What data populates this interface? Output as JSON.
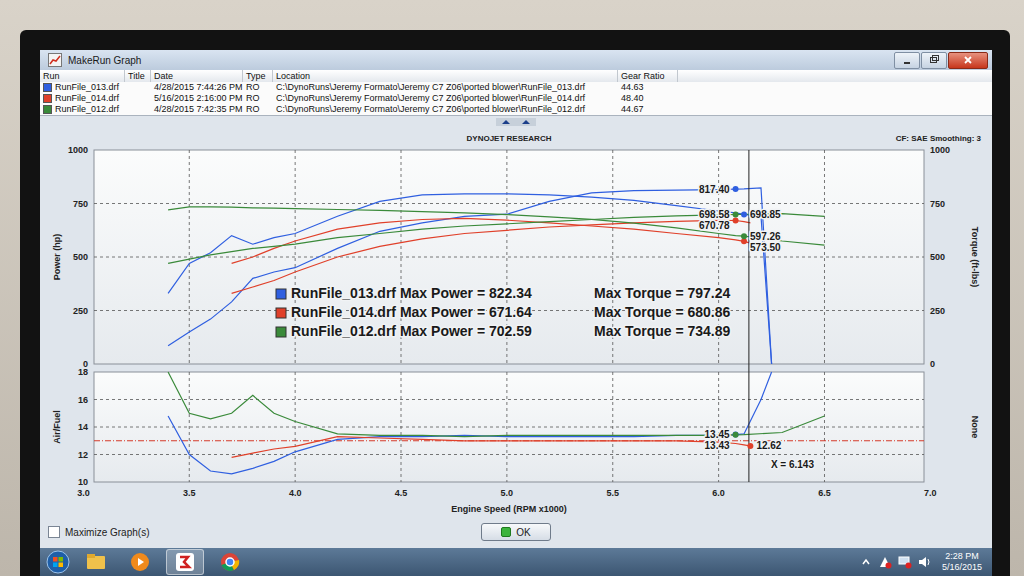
{
  "window": {
    "title": "MakeRun Graph"
  },
  "runs_table": {
    "columns": [
      "Run",
      "Title",
      "Date",
      "Type",
      "Location",
      "Gear Ratio"
    ],
    "rows": [
      {
        "run": "RunFile_013.drf",
        "date": "4/28/2015 7:44:26 PM",
        "type": "RO",
        "location": "C:\\DynoRuns\\Jeremy Formato\\Jeremy C7 Z06\\ported blower\\RunFile_013.drf",
        "gear_ratio": "44.63",
        "color": "#2f5fe0"
      },
      {
        "run": "RunFile_014.drf",
        "date": "5/16/2015 2:16:00 PM",
        "type": "RO",
        "location": "C:\\DynoRuns\\Jeremy Formato\\Jeremy C7 Z06\\ported blower\\RunFile_014.drf",
        "gear_ratio": "48.40",
        "color": "#e0402a"
      },
      {
        "run": "RunFile_012.drf",
        "date": "4/28/2015 7:42:35 PM",
        "type": "RO",
        "location": "C:\\DynoRuns\\Jeremy Formato\\Jeremy C7 Z06\\ported blower\\RunFile_012.drf",
        "gear_ratio": "44.67",
        "color": "#3a8a3a"
      }
    ]
  },
  "chart": {
    "brand": "DYNOJET RESEARCH",
    "settings": "CF: SAE  Smoothing: 3",
    "power_axis": {
      "label": "Power (hp)",
      "ticks": [
        "0",
        "250",
        "500",
        "750",
        "1000"
      ]
    },
    "torque_axis": {
      "label": "Torque (ft-lbs)",
      "ticks": [
        "0",
        "250",
        "500",
        "750",
        "1000"
      ]
    },
    "afr_axis": {
      "label": "Air/Fuel",
      "ticks": [
        "10",
        "12",
        "14",
        "16",
        "18"
      ]
    },
    "afr_right_label": "None",
    "x_axis": {
      "label": "Engine Speed (RPM x1000)",
      "ticks": [
        "3.0",
        "3.5",
        "4.0",
        "4.5",
        "5.0",
        "5.5",
        "6.0",
        "6.5",
        "7.0"
      ]
    },
    "cursor": {
      "rpm": 6.143,
      "label": "X = 6.143"
    },
    "afr_reference": 13.0,
    "series": [
      {
        "run": "RunFile_013.drf",
        "color": "#2f5fe0",
        "max_power": "Max Power = 822.34",
        "max_torque": "Max Torque = 797.24",
        "rpm": [
          3.4,
          3.5,
          3.6,
          3.7,
          3.8,
          3.9,
          4.0,
          4.2,
          4.4,
          4.6,
          4.8,
          5.0,
          5.2,
          5.4,
          5.6,
          5.8,
          6.0,
          6.08,
          6.12,
          6.2,
          6.25
        ],
        "power": [
          85,
          150,
          210,
          290,
          400,
          430,
          450,
          540,
          620,
          660,
          690,
          700,
          760,
          800,
          810,
          812,
          815,
          817.4,
          818,
          822.3,
          0
        ],
        "torque": [
          330,
          470,
          520,
          600,
          560,
          590,
          610,
          690,
          760,
          790,
          795,
          795,
          790,
          780,
          765,
          740,
          715,
          706,
          698.85,
          690,
          0
        ],
        "afr": [
          14.8,
          12,
          10.8,
          10.6,
          11,
          11.5,
          12.2,
          13.1,
          13.3,
          13.3,
          13.4,
          13.3,
          13.3,
          13.3,
          13.3,
          13.4,
          13.4,
          13.45,
          13.5,
          16,
          18
        ],
        "markers": [
          {
            "metric": "power",
            "rpm": 6.08,
            "label": "817.40"
          },
          {
            "metric": "torque",
            "rpm": 6.12,
            "label": "698.85"
          },
          {
            "metric": "afr",
            "rpm": 6.08,
            "label": "13.45"
          }
        ]
      },
      {
        "run": "RunFile_014.drf",
        "color": "#e0402a",
        "max_power": "Max Power = 671.64",
        "max_torque": "Max Torque = 680.86",
        "rpm": [
          3.7,
          3.8,
          3.9,
          4.0,
          4.2,
          4.4,
          4.6,
          4.8,
          5.0,
          5.2,
          5.4,
          5.6,
          5.8,
          6.0,
          6.08,
          6.12,
          6.15
        ],
        "power": [
          330,
          360,
          390,
          430,
          500,
          550,
          585,
          610,
          625,
          640,
          650,
          660,
          667,
          671.6,
          670.78,
          665,
          660
        ],
        "torque": [
          470,
          500,
          540,
          575,
          630,
          660,
          675,
          680.8,
          672,
          660,
          645,
          630,
          610,
          590,
          580,
          573.5,
          565
        ],
        "afr": [
          11.8,
          12.1,
          12.4,
          12.6,
          13.3,
          13.2,
          13.1,
          13.0,
          13.0,
          13.0,
          13.0,
          13.0,
          13.0,
          12.9,
          12.8,
          12.7,
          12.62
        ],
        "markers": [
          {
            "metric": "power",
            "rpm": 6.08,
            "label": "670.78"
          },
          {
            "metric": "torque",
            "rpm": 6.12,
            "label": "573.50"
          },
          {
            "metric": "afr",
            "rpm": 6.15,
            "label": "12.62"
          }
        ]
      },
      {
        "run": "RunFile_012.drf",
        "color": "#3a8a3a",
        "max_power": "Max Power = 702.59",
        "max_torque": "Max Torque = 734.89",
        "rpm": [
          3.4,
          3.5,
          3.6,
          3.7,
          3.8,
          3.9,
          4.0,
          4.2,
          4.4,
          4.6,
          4.8,
          5.0,
          5.2,
          5.4,
          5.6,
          5.8,
          6.0,
          6.08,
          6.12,
          6.3,
          6.5
        ],
        "power": [
          470,
          490,
          510,
          525,
          540,
          550,
          560,
          590,
          610,
          630,
          645,
          655,
          665,
          675,
          685,
          692,
          697,
          698.58,
          699,
          702.5,
          690
        ],
        "torque": [
          720,
          734.8,
          734,
          733,
          730,
          728,
          726,
          722,
          718,
          712,
          706,
          698,
          688,
          676,
          658,
          636,
          610,
          600,
          597.26,
          575,
          555
        ],
        "afr": [
          18,
          15,
          14.6,
          15,
          16.3,
          15,
          14.4,
          13.5,
          13.4,
          13.4,
          13.3,
          13.4,
          13.4,
          13.4,
          13.4,
          13.4,
          13.4,
          13.43,
          13.45,
          13.6,
          14.8
        ],
        "markers": [
          {
            "metric": "power",
            "rpm": 6.08,
            "label": "698.58"
          },
          {
            "metric": "torque",
            "rpm": 6.12,
            "label": "597.26"
          },
          {
            "metric": "afr",
            "rpm": 6.08,
            "label": "13.43"
          }
        ]
      }
    ]
  },
  "maximize": {
    "label": "Maximize Graph(s)",
    "checked": false
  },
  "buttons": [
    "OK"
  ],
  "taskbar": {
    "time": "2:28 PM",
    "date": "5/16/2015"
  }
}
